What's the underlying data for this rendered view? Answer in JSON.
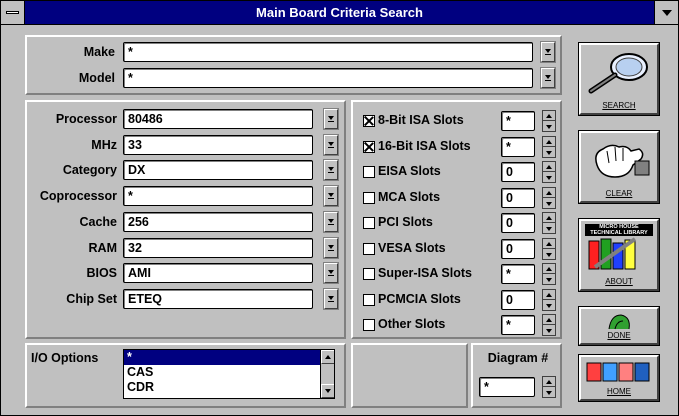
{
  "window": {
    "title": "Main Board Criteria Search"
  },
  "top_fields": [
    {
      "label": "Make",
      "value": "*"
    },
    {
      "label": "Model",
      "value": "*"
    }
  ],
  "left_fields": [
    {
      "label": "Processor",
      "value": "80486"
    },
    {
      "label": "MHz",
      "value": "33"
    },
    {
      "label": "Category",
      "value": "DX"
    },
    {
      "label": "Coprocessor",
      "value": "*"
    },
    {
      "label": "Cache",
      "value": "256"
    },
    {
      "label": "RAM",
      "value": "32"
    },
    {
      "label": "BIOS",
      "value": "AMI"
    },
    {
      "label": "Chip Set",
      "value": "ETEQ"
    }
  ],
  "slots": [
    {
      "label": "8-Bit ISA Slots",
      "checked": true,
      "value": "*"
    },
    {
      "label": "16-Bit ISA Slots",
      "checked": true,
      "value": "*"
    },
    {
      "label": "EISA Slots",
      "checked": false,
      "value": "0"
    },
    {
      "label": "MCA Slots",
      "checked": false,
      "value": "0"
    },
    {
      "label": "PCI Slots",
      "checked": false,
      "value": "0"
    },
    {
      "label": "VESA Slots",
      "checked": false,
      "value": "0"
    },
    {
      "label": "Super-ISA Slots",
      "checked": false,
      "value": "*"
    },
    {
      "label": "PCMCIA Slots",
      "checked": false,
      "value": "0"
    },
    {
      "label": "Other Slots",
      "checked": false,
      "value": "*"
    }
  ],
  "io_options": {
    "label": "I/O Options",
    "items": [
      "*",
      "CAS",
      "CDR"
    ],
    "selected": "*"
  },
  "diagram": {
    "label": "Diagram #",
    "value": "*"
  },
  "buttons": {
    "search": "SEARCH",
    "clear": "CLEAR",
    "about": "ABOUT",
    "about_banner": "MICRO HOUSE TECHNICAL LIBRARY",
    "done": "DONE",
    "home": "HOME"
  },
  "colors": {
    "title_bar": "#000080",
    "window_face": "#c0c0c0",
    "selection": "#000080"
  }
}
